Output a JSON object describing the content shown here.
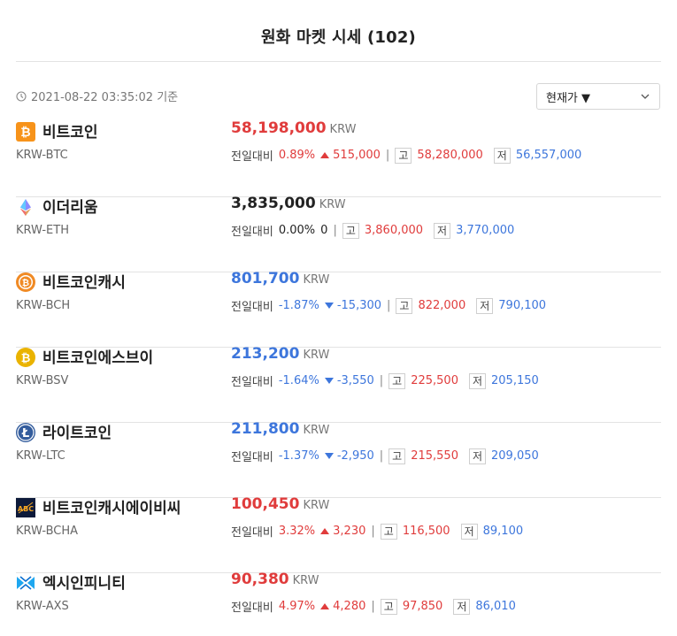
{
  "title": "원화 마켓 시세 (102)",
  "timestamp": "2021-08-22 03:35:02 기준",
  "sort": {
    "label": "현재가 ▼"
  },
  "labels": {
    "change": "전일대비",
    "high": "고",
    "low": "저",
    "unit": "KRW"
  },
  "colors": {
    "up": "#e03c3c",
    "down": "#3d76dc",
    "flat": "#222222"
  },
  "coins": [
    {
      "icon": "bitcoin-icon",
      "name": "비트코인",
      "code": "KRW-BTC",
      "price": "58,198,000",
      "trend": "up",
      "rate": "0.89%",
      "change": "515,000",
      "high": "58,280,000",
      "low": "56,557,000"
    },
    {
      "icon": "ethereum-icon",
      "name": "이더리움",
      "code": "KRW-ETH",
      "price": "3,835,000",
      "trend": "flat",
      "rate": "0.00%",
      "change": "0",
      "high": "3,860,000",
      "low": "3,770,000"
    },
    {
      "icon": "bitcoin-cash-icon",
      "name": "비트코인캐시",
      "code": "KRW-BCH",
      "price": "801,700",
      "trend": "down",
      "rate": "-1.87%",
      "change": "-15,300",
      "high": "822,000",
      "low": "790,100"
    },
    {
      "icon": "bitcoin-sv-icon",
      "name": "비트코인에스브이",
      "code": "KRW-BSV",
      "price": "213,200",
      "trend": "down",
      "rate": "-1.64%",
      "change": "-3,550",
      "high": "225,500",
      "low": "205,150"
    },
    {
      "icon": "litecoin-icon",
      "name": "라이트코인",
      "code": "KRW-LTC",
      "price": "211,800",
      "trend": "down",
      "rate": "-1.37%",
      "change": "-2,950",
      "high": "215,550",
      "low": "209,050"
    },
    {
      "icon": "bitcoin-abc-icon",
      "name": "비트코인캐시에이비씨",
      "code": "KRW-BCHA",
      "price": "100,450",
      "trend": "up",
      "rate": "3.32%",
      "change": "3,230",
      "high": "116,500",
      "low": "89,100"
    },
    {
      "icon": "axie-infinity-icon",
      "name": "엑시인피니티",
      "code": "KRW-AXS",
      "price": "90,380",
      "trend": "up",
      "rate": "4.97%",
      "change": "4,280",
      "high": "97,850",
      "low": "86,010"
    }
  ]
}
